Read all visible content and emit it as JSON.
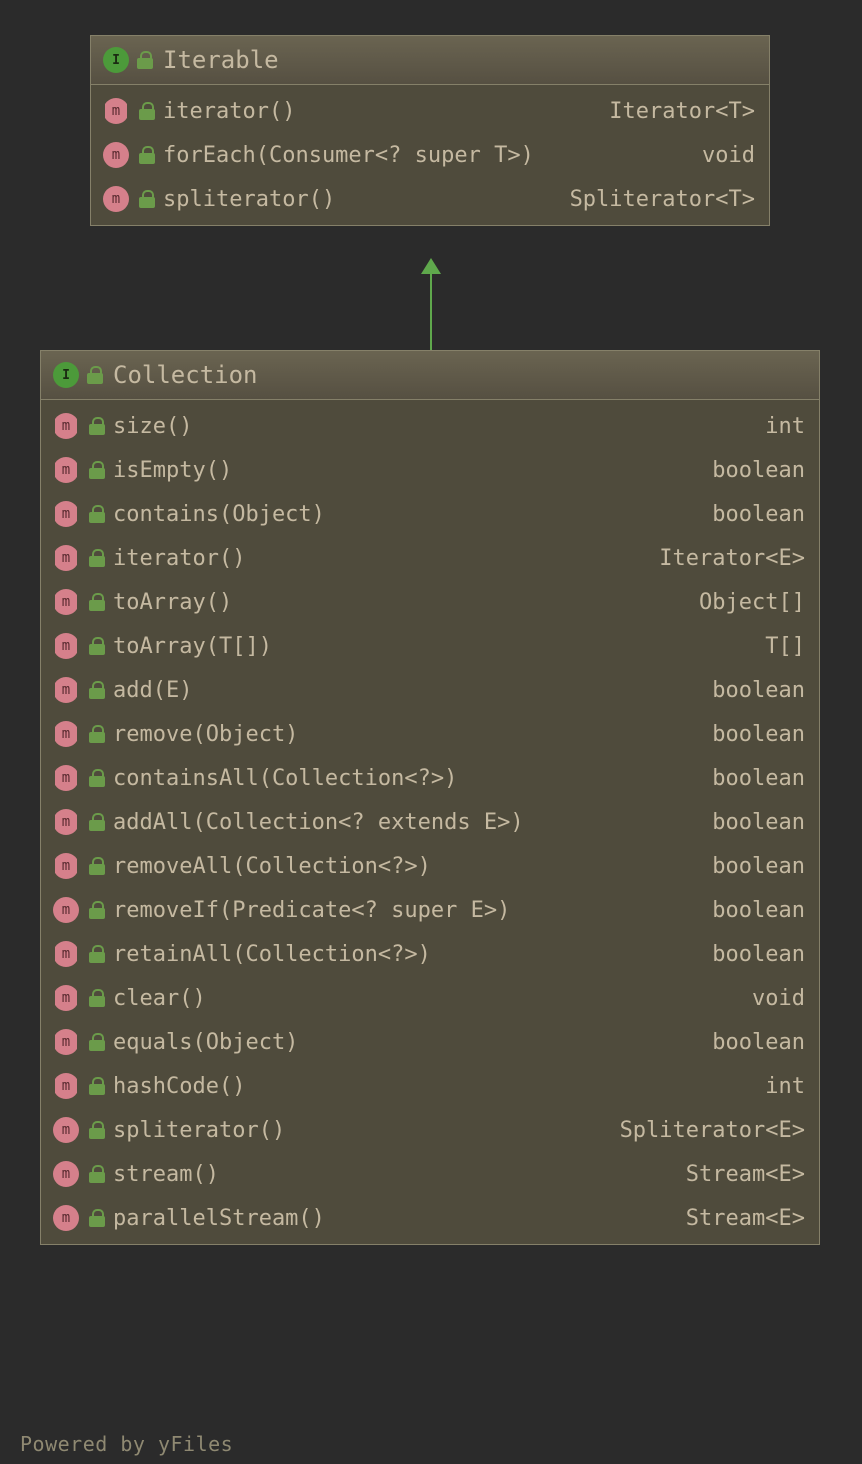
{
  "colors": {
    "background": "#2b2b2b",
    "node_bg": "#4f4b3c",
    "node_border": "#858069",
    "text": "#c5b9a1",
    "interface_icon": "#4c9a3a",
    "method_icon": "#d5808b",
    "lock_icon": "#6b9b4a",
    "arrow": "#5fa84c"
  },
  "nodes": [
    {
      "id": "iterable",
      "kind": "interface",
      "kind_letter": "I",
      "title": "Iterable",
      "lock": "closed",
      "methods": [
        {
          "abstract": true,
          "lock": "closed",
          "signature": "iterator()",
          "return": "Iterator<T>"
        },
        {
          "abstract": false,
          "lock": "closed",
          "signature": "forEach(Consumer<? super T>)",
          "return": "void"
        },
        {
          "abstract": false,
          "lock": "closed",
          "signature": "spliterator()",
          "return": "Spliterator<T>"
        }
      ]
    },
    {
      "id": "collection",
      "kind": "interface",
      "kind_letter": "I",
      "title": "Collection",
      "lock": "closed",
      "methods": [
        {
          "abstract": true,
          "lock": "closed",
          "signature": "size()",
          "return": "int"
        },
        {
          "abstract": true,
          "lock": "closed",
          "signature": "isEmpty()",
          "return": "boolean"
        },
        {
          "abstract": true,
          "lock": "closed",
          "signature": "contains(Object)",
          "return": "boolean"
        },
        {
          "abstract": true,
          "lock": "closed",
          "signature": "iterator()",
          "return": "Iterator<E>"
        },
        {
          "abstract": true,
          "lock": "closed",
          "signature": "toArray()",
          "return": "Object[]"
        },
        {
          "abstract": true,
          "lock": "closed",
          "signature": "toArray(T[])",
          "return": "T[]"
        },
        {
          "abstract": true,
          "lock": "closed",
          "signature": "add(E)",
          "return": "boolean"
        },
        {
          "abstract": true,
          "lock": "closed",
          "signature": "remove(Object)",
          "return": "boolean"
        },
        {
          "abstract": true,
          "lock": "closed",
          "signature": "containsAll(Collection<?>)",
          "return": "boolean"
        },
        {
          "abstract": true,
          "lock": "closed",
          "signature": "addAll(Collection<? extends E>)",
          "return": "boolean"
        },
        {
          "abstract": true,
          "lock": "closed",
          "signature": "removeAll(Collection<?>)",
          "return": "boolean"
        },
        {
          "abstract": false,
          "lock": "closed",
          "signature": "removeIf(Predicate<? super E>)",
          "return": "boolean"
        },
        {
          "abstract": true,
          "lock": "closed",
          "signature": "retainAll(Collection<?>)",
          "return": "boolean"
        },
        {
          "abstract": true,
          "lock": "closed",
          "signature": "clear()",
          "return": "void"
        },
        {
          "abstract": true,
          "lock": "closed",
          "signature": "equals(Object)",
          "return": "boolean"
        },
        {
          "abstract": true,
          "lock": "closed",
          "signature": "hashCode()",
          "return": "int"
        },
        {
          "abstract": false,
          "lock": "closed",
          "signature": "spliterator()",
          "return": "Spliterator<E>"
        },
        {
          "abstract": false,
          "lock": "closed",
          "signature": "stream()",
          "return": "Stream<E>"
        },
        {
          "abstract": false,
          "lock": "closed",
          "signature": "parallelStream()",
          "return": "Stream<E>"
        }
      ]
    }
  ],
  "edges": [
    {
      "from": "collection",
      "to": "iterable",
      "type": "generalization"
    }
  ],
  "watermark": "Powered by yFiles"
}
